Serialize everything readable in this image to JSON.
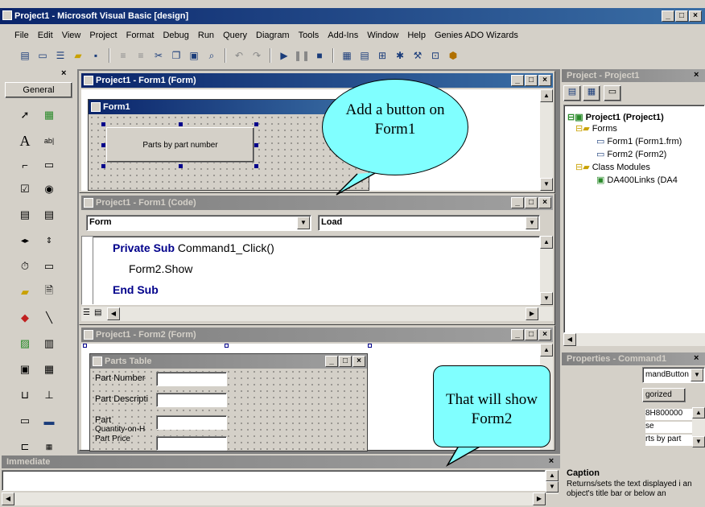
{
  "app": {
    "title": "Project1 - Microsoft Visual Basic [design]",
    "minimize": "_",
    "maximize": "□",
    "close": "×"
  },
  "menu": [
    "File",
    "Edit",
    "View",
    "Project",
    "Format",
    "Debug",
    "Run",
    "Query",
    "Diagram",
    "Tools",
    "Add-Ins",
    "Window",
    "Help",
    "Genies ADO Wizards"
  ],
  "toolbox": {
    "title": "General",
    "close": "×"
  },
  "form_designer": {
    "title": "Project1 - Form1 (Form)",
    "form_title": "Form1",
    "button_caption": "Parts by part number"
  },
  "code_window": {
    "title": "Project1 - Form1 (Code)",
    "object_combo": "Form",
    "proc_combo": "Load",
    "lines": [
      "Private Sub",
      " Command1_Click()",
      "Form2.Show",
      "End Sub"
    ]
  },
  "form2_designer": {
    "title": "Project1 - Form2 (Form)",
    "form_title": "Parts Table",
    "fields": [
      "Part Number",
      "Part Descripti",
      "Part",
      "Quantity-on-H",
      "Part Price"
    ]
  },
  "immediate": {
    "title": "Immediate",
    "close": "×"
  },
  "project_explorer": {
    "title": "Project - Project1",
    "close": "×",
    "items": [
      {
        "label": "Project1 (Project1)"
      },
      {
        "label": "Forms"
      },
      {
        "label": "Form1 (Form1.frm)"
      },
      {
        "label": "Form2 (Form2)"
      },
      {
        "label": "Class Modules"
      },
      {
        "label": "DA400Links (DA4"
      }
    ]
  },
  "properties": {
    "title": "Properties - Command1",
    "close": "×",
    "object_combo": "mandButton",
    "tab": "gorized",
    "rows": [
      "8H800000",
      "se",
      "rts by part"
    ],
    "caption_title": "Caption",
    "caption_desc": "Returns/sets the text displayed i an object's title bar or below an"
  },
  "callouts": {
    "top": "Add a button on Form1",
    "bottom": "That will show Form2"
  }
}
